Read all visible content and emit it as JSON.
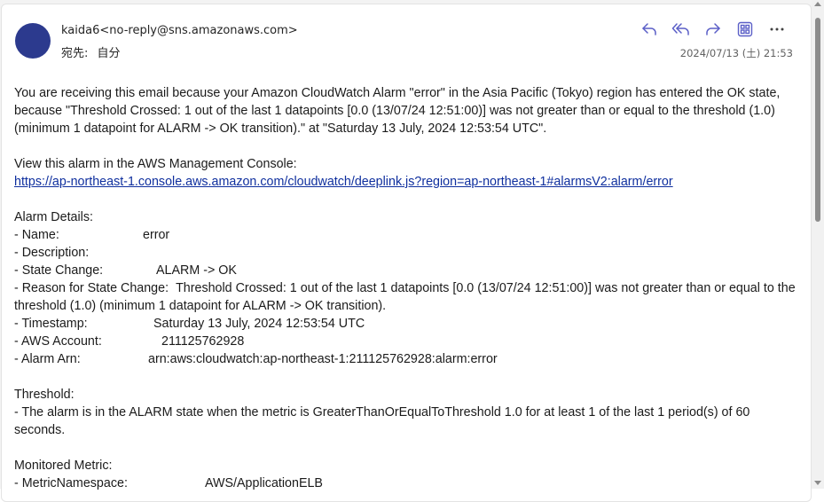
{
  "header": {
    "sender": "kaida6<no-reply@sns.amazonaws.com>",
    "to_label": "宛先:",
    "to_value": "自分",
    "date": "2024/07/13 (土) 21:53"
  },
  "toolbar": {
    "reply_icon": "reply-icon",
    "reply_all_icon": "reply-all-icon",
    "forward_icon": "forward-icon",
    "apps_icon": "apps-icon",
    "more_icon": "more-icon"
  },
  "colors": {
    "accent": "#5b5fc7",
    "avatar": "#2c3a8e",
    "link": "#0f2f9e"
  },
  "body": {
    "intro": "You are receiving this email because your Amazon CloudWatch Alarm \"error\" in the Asia Pacific (Tokyo) region has entered the OK state, because \"Threshold Crossed: 1 out of the last 1 datapoints [0.0 (13/07/24 12:51:00)] was not greater than or equal to the threshold (1.0) (minimum 1 datapoint for ALARM -> OK transition).\" at \"Saturday 13 July, 2024 12:53:54 UTC\".",
    "console_label": "View this alarm in the AWS Management Console:",
    "console_link": "https://ap-northeast-1.console.aws.amazon.com/cloudwatch/deeplink.js?region=ap-northeast-1#alarmsV2:alarm/error",
    "alarm_details_title": "Alarm Details:",
    "details": {
      "name_key": "- Name:",
      "name_val": "error",
      "description_key": "- Description:",
      "state_change_key": "- State Change:",
      "state_change_val": "ALARM -> OK",
      "reason_key": "- Reason for State Change:",
      "reason_val": "Threshold Crossed: 1 out of the last 1 datapoints [0.0 (13/07/24 12:51:00)] was not greater than or equal to the threshold (1.0) (minimum 1 datapoint for ALARM -> OK transition).",
      "timestamp_key": "- Timestamp:",
      "timestamp_val": "Saturday 13 July, 2024 12:53:54 UTC",
      "account_key": "- AWS Account:",
      "account_val": "211125762928",
      "arn_key": "- Alarm Arn:",
      "arn_val": "arn:aws:cloudwatch:ap-northeast-1:211125762928:alarm:error"
    },
    "threshold_title": "Threshold:",
    "threshold_text": "- The alarm is in the ALARM state when the metric is GreaterThanOrEqualToThreshold 1.0 for at least 1 of the last 1 period(s) of 60 seconds.",
    "metric_title": "Monitored Metric:",
    "metric_namespace_key": "- MetricNamespace:",
    "metric_namespace_val": "AWS/ApplicationELB"
  }
}
